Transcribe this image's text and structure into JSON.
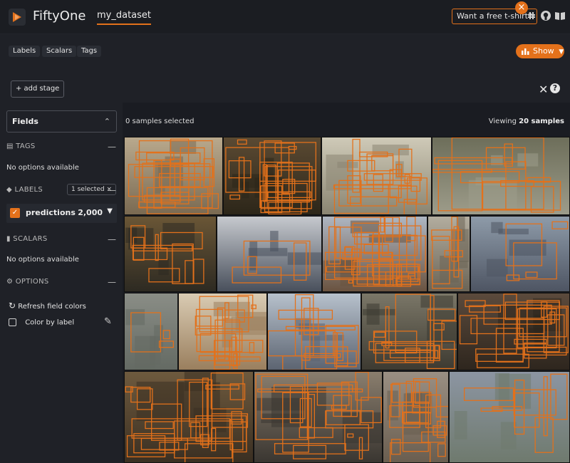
{
  "header": {
    "app_name": "FiftyOne",
    "dataset_name": "my_dataset",
    "promo": "Want a free t-shirt?",
    "icons": [
      "close-icon",
      "slack-icon",
      "github-icon",
      "docs-icon"
    ]
  },
  "toolbar": {
    "tabs": [
      "Labels",
      "Scalars",
      "Tags"
    ],
    "show_label": "Show"
  },
  "view_bar": {
    "add_stage_label": "+ add stage"
  },
  "sidebar": {
    "fields_label": "Fields",
    "tags": {
      "title": "TAGS",
      "empty": "No options available"
    },
    "labels": {
      "title": "LABELS",
      "selected": "1 selected ×",
      "field_name": "predictions",
      "field_count": "2,000"
    },
    "scalars": {
      "title": "SCALARS",
      "empty": "No options available"
    },
    "options": {
      "title": "OPTIONS",
      "refresh": "Refresh field colors",
      "color_by": "Color by label"
    }
  },
  "main": {
    "selected_text": "0 samples selected",
    "viewing_prefix": "Viewing",
    "viewing_count": "20 samples"
  },
  "colors": {
    "accent": "#e3711b",
    "background": "#1a1c22",
    "panel": "#1f2127"
  },
  "samples": [
    {
      "id": "s1",
      "bg": "#b9a98d",
      "mid": "#7a6a52",
      "boxes": 18
    },
    {
      "id": "s2",
      "bg": "#5b4a33",
      "mid": "#2c2619",
      "boxes": 22
    },
    {
      "id": "s3",
      "bg": "#cfcab8",
      "mid": "#8a8572",
      "boxes": 20
    },
    {
      "id": "s4",
      "bg": "#6d6e5a",
      "mid": "#9d9c8a",
      "boxes": 12
    },
    {
      "id": "s5",
      "bg": "#6a5636",
      "mid": "#2d2a22",
      "boxes": 10
    },
    {
      "id": "s6",
      "bg": "#c6c9ce",
      "mid": "#49505c",
      "boxes": 4
    },
    {
      "id": "s7",
      "bg": "#aeb6c2",
      "mid": "#6a5340",
      "boxes": 30
    },
    {
      "id": "s8",
      "bg": "#b3ad9f",
      "mid": "#6b6456",
      "boxes": 6
    },
    {
      "id": "s9",
      "bg": "#8e9ba9",
      "mid": "#4e5563",
      "boxes": 5
    },
    {
      "id": "s10",
      "bg": "#8a8d86",
      "mid": "#646a63",
      "boxes": 3
    },
    {
      "id": "s11",
      "bg": "#d9cbb3",
      "mid": "#9a7f5e",
      "boxes": 18
    },
    {
      "id": "s12",
      "bg": "#b7c1cc",
      "mid": "#5c6471",
      "boxes": 14
    },
    {
      "id": "s13",
      "bg": "#7b7768",
      "mid": "#3d3a31",
      "boxes": 16
    },
    {
      "id": "s14",
      "bg": "#5b4a3c",
      "mid": "#2e261e",
      "boxes": 20
    },
    {
      "id": "s15",
      "bg": "#6e5a3e",
      "mid": "#3a2f22",
      "boxes": 26
    },
    {
      "id": "s16",
      "bg": "#8a7e6e",
      "mid": "#3a3631",
      "boxes": 22
    },
    {
      "id": "s17",
      "bg": "#9a8f83",
      "mid": "#6a5e50",
      "boxes": 18
    },
    {
      "id": "s18",
      "bg": "#8c95a2",
      "mid": "#6f7a6e",
      "boxes": 9
    }
  ]
}
